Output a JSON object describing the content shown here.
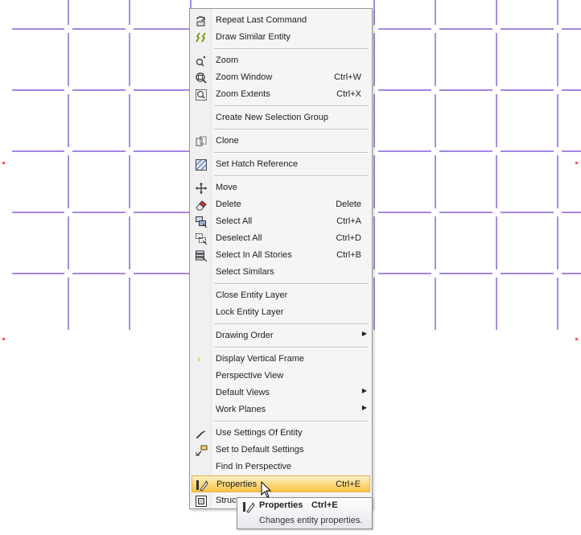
{
  "canvas": {
    "grid_color": "#6f3fd0"
  },
  "context_menu": {
    "items": [
      {
        "label": "Repeat Last Command",
        "shortcut": "",
        "icon": "repeat-command-icon"
      },
      {
        "label": "Draw Similar Entity",
        "shortcut": "",
        "icon": "draw-similar-icon"
      },
      {
        "label": "Zoom",
        "shortcut": "",
        "icon": "zoom-icon"
      },
      {
        "label": "Zoom Window",
        "shortcut": "Ctrl+W",
        "icon": "zoom-window-icon"
      },
      {
        "label": "Zoom Extents",
        "shortcut": "Ctrl+X",
        "icon": "zoom-extents-icon"
      },
      {
        "label": "Create New Selection Group",
        "shortcut": "",
        "icon": ""
      },
      {
        "label": "Clone",
        "shortcut": "",
        "icon": "clone-icon"
      },
      {
        "label": "Set Hatch Reference",
        "shortcut": "",
        "icon": "hatch-icon"
      },
      {
        "label": "Move",
        "shortcut": "",
        "icon": "move-icon"
      },
      {
        "label": "Delete",
        "shortcut": "Delete",
        "icon": "eraser-icon"
      },
      {
        "label": "Select All",
        "shortcut": "Ctrl+A",
        "icon": "select-all-icon"
      },
      {
        "label": "Deselect All",
        "shortcut": "Ctrl+D",
        "icon": "deselect-all-icon"
      },
      {
        "label": "Select In All Stories",
        "shortcut": "Ctrl+B",
        "icon": "select-stories-icon"
      },
      {
        "label": "Select Similars",
        "shortcut": "",
        "icon": ""
      },
      {
        "label": "Close Entity Layer",
        "shortcut": "",
        "icon": ""
      },
      {
        "label": "Lock Entity Layer",
        "shortcut": "",
        "icon": ""
      },
      {
        "label": "Drawing Order",
        "shortcut": "",
        "icon": "",
        "submenu": true
      },
      {
        "label": "Display Vertical Frame",
        "shortcut": "",
        "icon": "vertical-frame-icon"
      },
      {
        "label": "Perspective View",
        "shortcut": "",
        "icon": ""
      },
      {
        "label": "Default Views",
        "shortcut": "",
        "icon": "",
        "submenu": true
      },
      {
        "label": "Work Planes",
        "shortcut": "",
        "icon": "",
        "submenu": true
      },
      {
        "label": "Use Settings Of Entity",
        "shortcut": "",
        "icon": "eyedropper-icon"
      },
      {
        "label": "Set to Default Settings",
        "shortcut": "",
        "icon": "default-settings-icon"
      },
      {
        "label": "Find In Perspective",
        "shortcut": "",
        "icon": ""
      },
      {
        "label": "Properties",
        "shortcut": "Ctrl+E",
        "icon": "properties-icon",
        "highlighted": true
      },
      {
        "label": "Struc",
        "shortcut": "",
        "icon": "structure-icon"
      }
    ]
  },
  "tooltip": {
    "title": "Properties",
    "shortcut": "Ctrl+E",
    "description": "Changes entity properties."
  }
}
